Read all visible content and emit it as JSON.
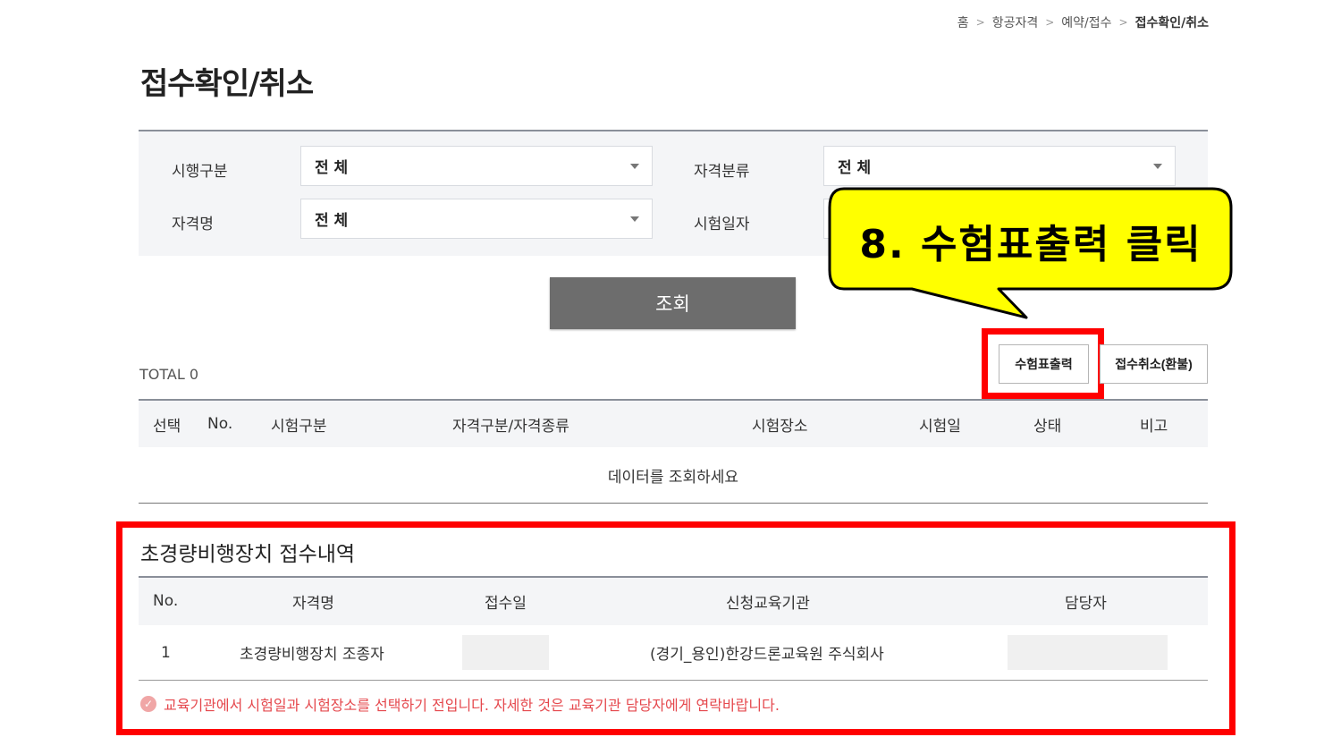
{
  "breadcrumb": {
    "home": "홈",
    "level1": "항공자격",
    "level2": "예약/접수",
    "current": "접수확인/취소",
    "separator": ">"
  },
  "page": {
    "title": "접수확인/취소"
  },
  "search": {
    "exec_type_label": "시행구분",
    "exec_type_value": "전 체",
    "category_label": "자격분류",
    "category_value": "전 체",
    "qual_name_label": "자격명",
    "qual_name_value": "전 체",
    "exam_date_label": "시험일자",
    "search_button": "조회"
  },
  "callout": {
    "text": "8. 수험표출력 클릭",
    "color": "#ffff00"
  },
  "result": {
    "total": "TOTAL 0",
    "print_button": "수험표출력",
    "cancel_button": "접수취소(환불)",
    "columns": [
      "선택",
      "No.",
      "시험구분",
      "자격구분/자격종류",
      "시험장소",
      "시험일",
      "상태",
      "비고"
    ],
    "empty_message": "데이터를 조회하세요"
  },
  "drone": {
    "title": "초경량비행장치 접수내역",
    "columns": [
      "No.",
      "자격명",
      "접수일",
      "신청교육기관",
      "담당자"
    ],
    "rows": [
      {
        "no": "1",
        "qual_name": "초경량비행장치 조종자",
        "institution": "(경기_용인)한강드론교육원 주식회사"
      }
    ],
    "notice": "교육기관에서 시험일과 시험장소를 선택하기 전입니다. 자세한 것은 교육기관 담당자에게 연락바랍니다.",
    "notice_icon": "✓"
  },
  "colors": {
    "highlight": "#ff0000",
    "notice": "#e5484d"
  }
}
